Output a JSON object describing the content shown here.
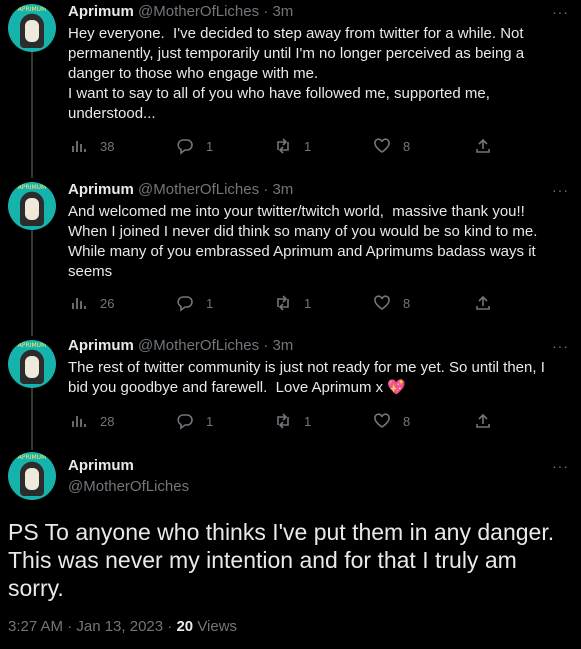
{
  "tweets": [
    {
      "name": "Aprimum",
      "handle": "@MotherOfLiches",
      "time": "3m",
      "lines": [
        "Hey everyone.  I've decided to step away from twitter for a while. Not",
        "permanently, just temporarily until I'm no longer perceived as being a",
        "danger to those who engage with me.",
        "I want to say to all of you who have followed me, supported me,",
        "understood..."
      ],
      "views": "38",
      "replies": "1",
      "retweets": "1",
      "likes": "8"
    },
    {
      "name": "Aprimum",
      "handle": "@MotherOfLiches",
      "time": "3m",
      "lines": [
        "And welcomed me into your twitter/twitch world,  massive thank you!!",
        "When I joined I never did think so many of you would be so kind to me.",
        "While many of you embrassed Aprimum and Aprimums badass ways it",
        "seems"
      ],
      "views": "26",
      "replies": "1",
      "retweets": "1",
      "likes": "8"
    },
    {
      "name": "Aprimum",
      "handle": "@MotherOfLiches",
      "time": "3m",
      "lines": [
        "The rest of twitter community is just not ready for me yet. So until then, I",
        "bid you goodbye and farewell.  Love Aprimum x"
      ],
      "emoji": "💖",
      "views": "28",
      "replies": "1",
      "retweets": "1",
      "likes": "8"
    }
  ],
  "main_tweet": {
    "name": "Aprimum",
    "handle": "@MotherOfLiches",
    "lines": [
      "PS To anyone who thinks I've put them in any danger.",
      "This was never my intention and for that I truly am",
      "sorry."
    ],
    "timestamp": "3:27 AM · Jan 13, 2023",
    "views_count": "20",
    "views_label": "Views"
  },
  "common": {
    "dot": "·",
    "more": "···",
    "avatar_banner": "APRIMUM"
  },
  "colors": {
    "background": "#000000",
    "text": "#e7e9ea",
    "secondary": "#71767b",
    "divider": "#2f3336",
    "heart": "#f91880"
  },
  "icons": {
    "views": "bar-chart-icon",
    "reply": "reply-bubble-icon",
    "retweet": "retweet-icon",
    "like": "heart-icon",
    "share": "share-icon",
    "more": "more-dots-icon"
  }
}
